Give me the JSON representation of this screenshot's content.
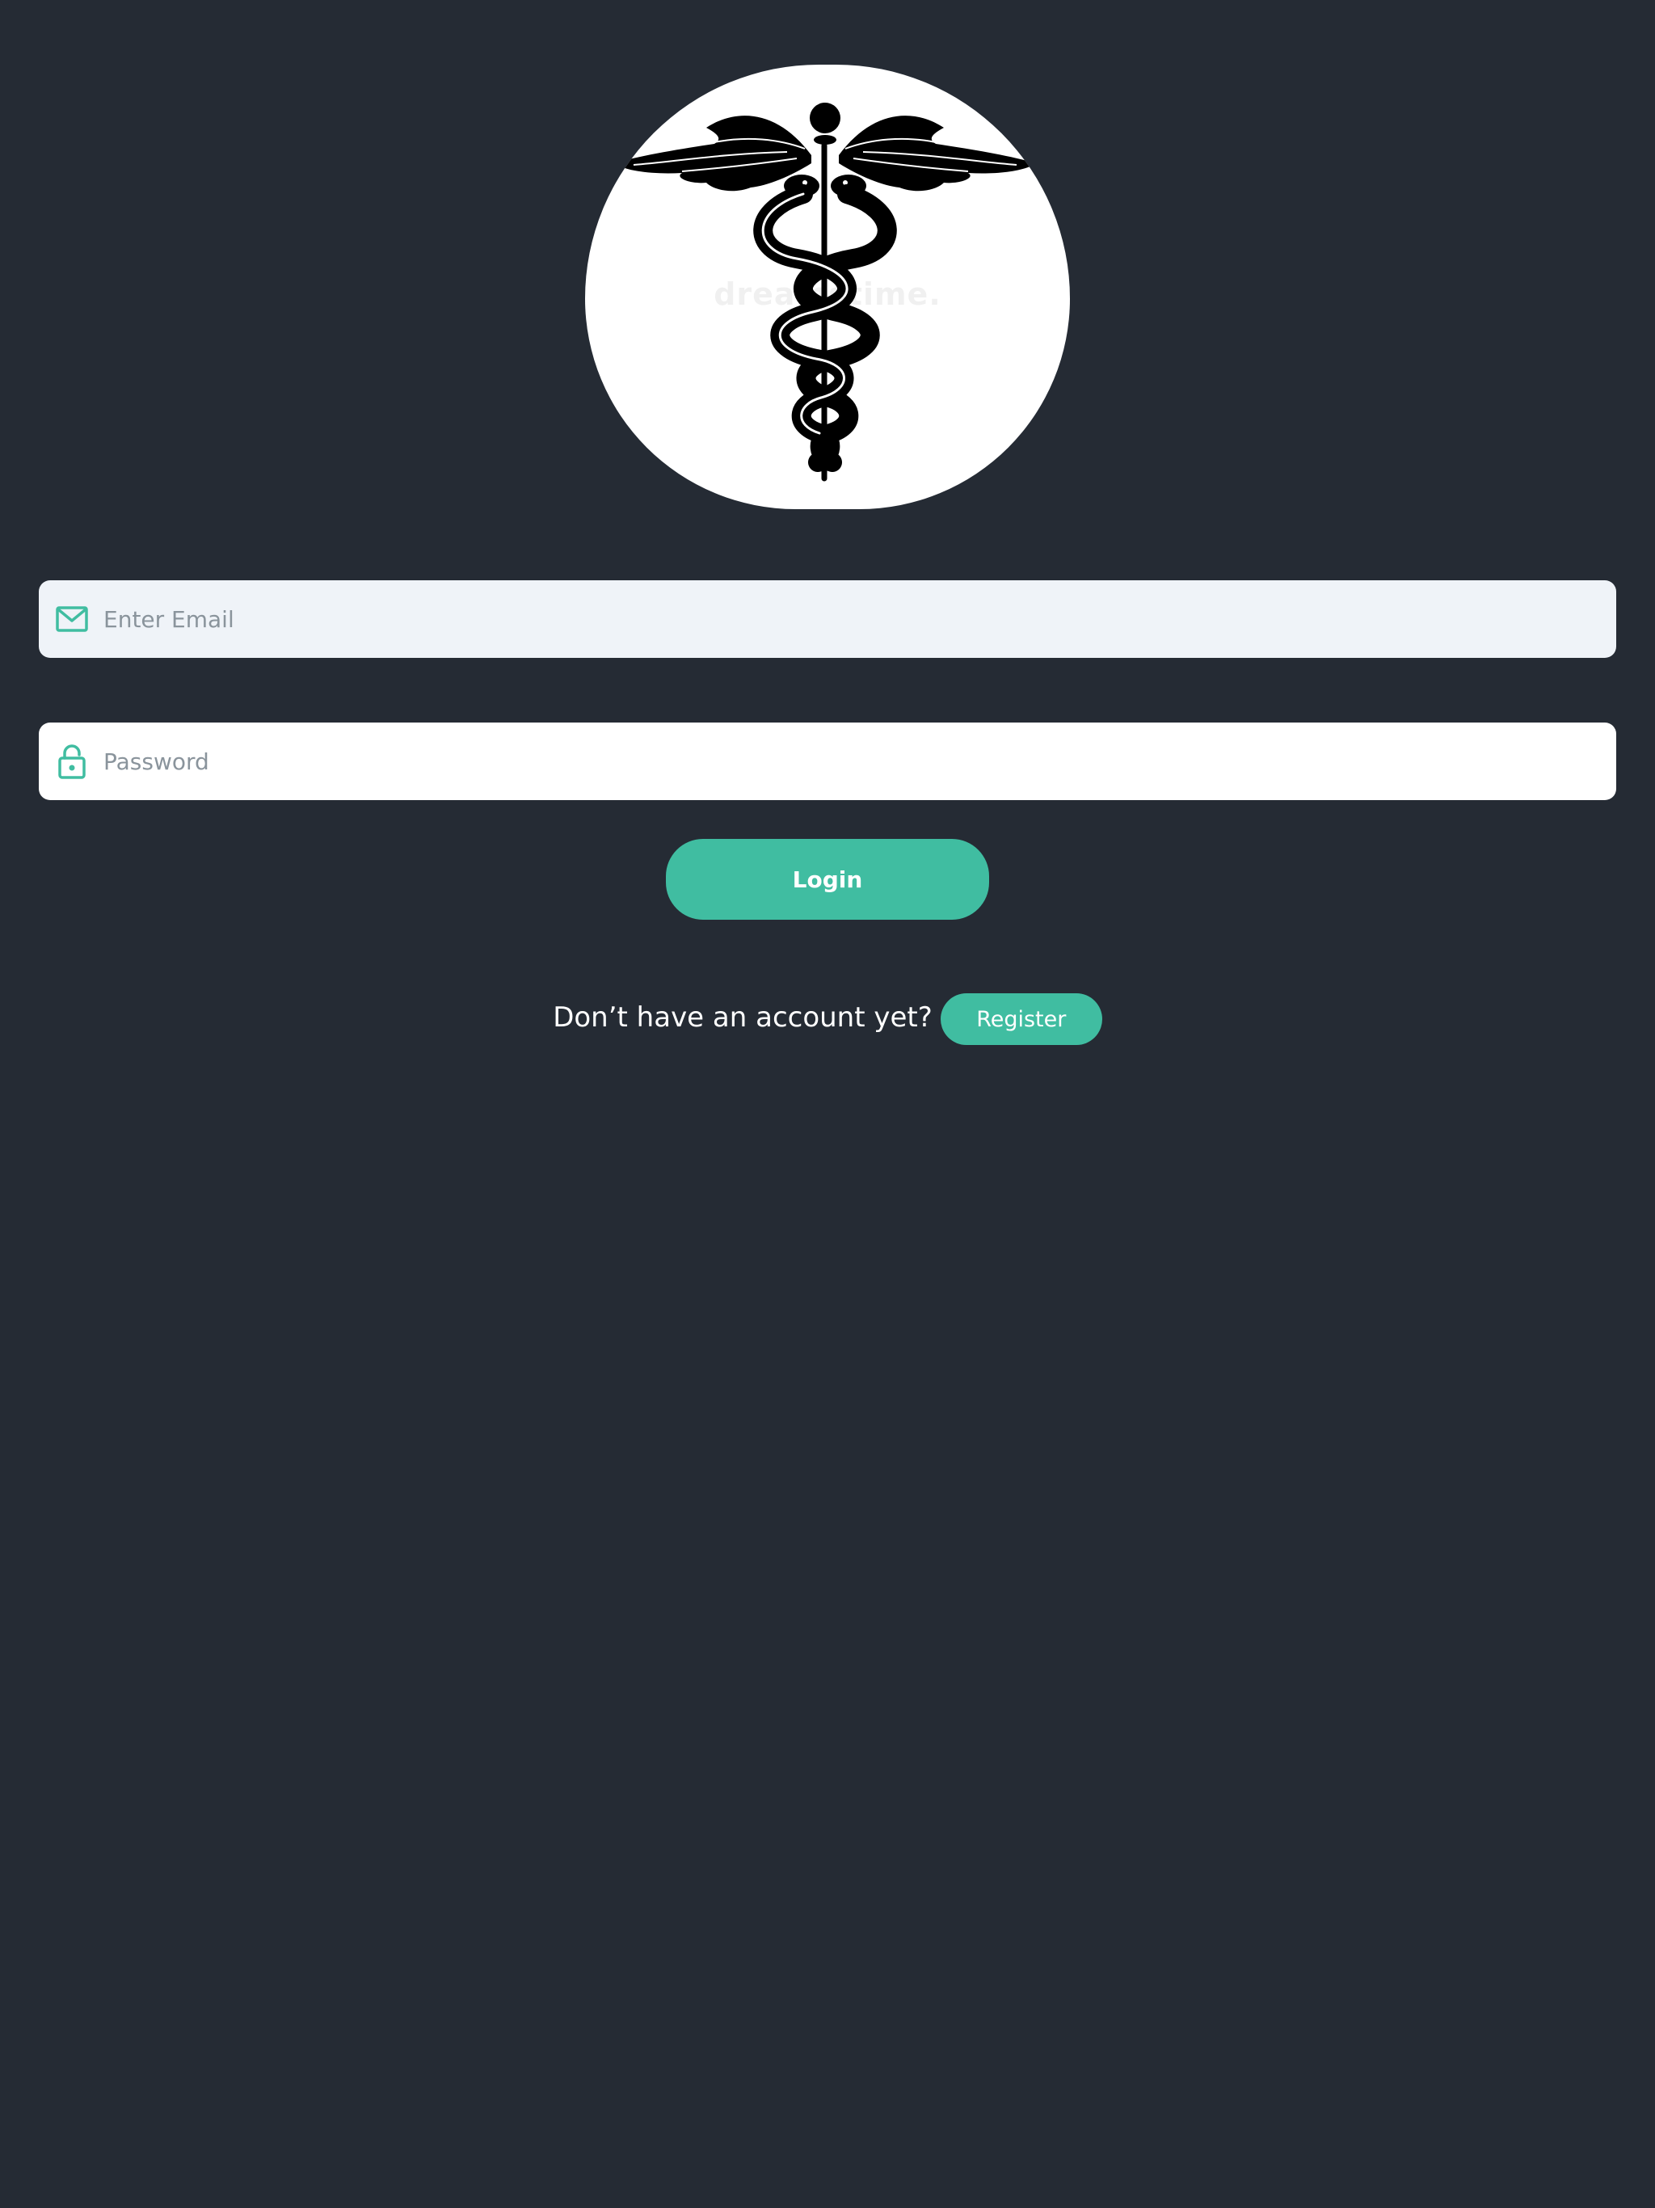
{
  "logo": {
    "icon": "caduceus-icon",
    "watermark_text": "dreamstime."
  },
  "form": {
    "email": {
      "placeholder": "Enter Email",
      "value": "",
      "icon": "mail-icon"
    },
    "password": {
      "placeholder": "Password",
      "value": "",
      "icon": "lock-icon"
    },
    "login_label": "Login"
  },
  "register": {
    "prompt": "Don’t have an account yet?",
    "button_label": "Register"
  },
  "colors": {
    "background": "#252b34",
    "accent": "#40bda1",
    "email_field_bg": "#eff3f8",
    "password_field_bg": "#ffffff",
    "placeholder_text": "#8a949c"
  }
}
